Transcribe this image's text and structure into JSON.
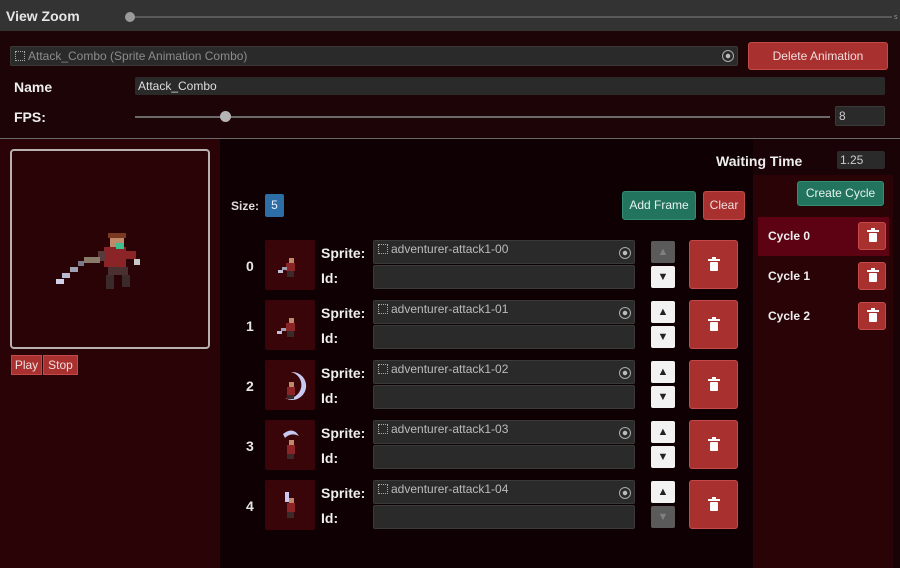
{
  "toolbar": {
    "zoom_label": "View Zoom"
  },
  "animation": {
    "field_value": "Attack_Combo (Sprite Animation Combo)",
    "delete_label": "Delete Animation",
    "name_label": "Name",
    "name_value": "Attack_Combo",
    "fps_label": "FPS:",
    "fps_value": "8",
    "fps_slider_fraction": 0.13
  },
  "preview": {
    "play_label": "Play",
    "stop_label": "Stop"
  },
  "frames_panel": {
    "waiting_label": "Waiting Time",
    "waiting_value": "1.25",
    "size_label": "Size:",
    "size_value": "5",
    "add_frame_label": "Add Frame",
    "clear_label": "Clear",
    "sprite_label": "Sprite:",
    "id_label": "Id:",
    "frames": [
      {
        "index": "0",
        "sprite": "adventurer-attack1-00",
        "id": ""
      },
      {
        "index": "1",
        "sprite": "adventurer-attack1-01",
        "id": ""
      },
      {
        "index": "2",
        "sprite": "adventurer-attack1-02",
        "id": ""
      },
      {
        "index": "3",
        "sprite": "adventurer-attack1-03",
        "id": ""
      },
      {
        "index": "4",
        "sprite": "adventurer-attack1-04",
        "id": ""
      }
    ]
  },
  "cycles": {
    "create_label": "Create Cycle",
    "items": [
      {
        "label": "Cycle 0",
        "selected": true
      },
      {
        "label": "Cycle 1",
        "selected": false
      },
      {
        "label": "Cycle 2",
        "selected": false
      }
    ]
  },
  "colors": {
    "accent_red": "#a8302f",
    "accent_green": "#23745e",
    "size_badge": "#2c6ea5",
    "selected_cycle": "#5c0212"
  },
  "icons": {
    "delete": "trash-icon",
    "move_up": "arrow-up-icon",
    "move_down": "arrow-down-icon",
    "object_picker": "target-icon",
    "asset": "asset-icon"
  }
}
